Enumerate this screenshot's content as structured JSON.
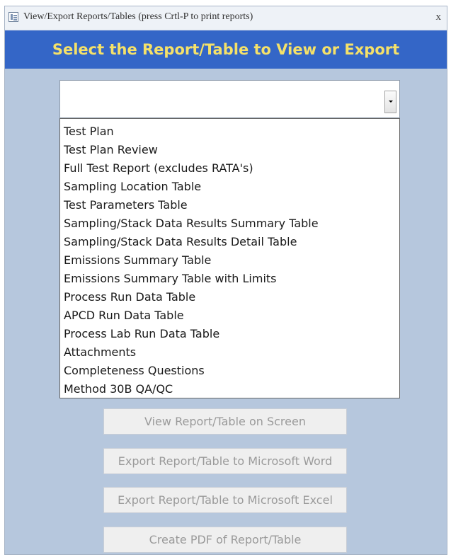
{
  "window": {
    "title": "View/Export Reports/Tables (press Crtl-P to print reports)",
    "close_label": "x"
  },
  "header": {
    "title": "Select the Report/Table to View or Export",
    "background": "#3466c7",
    "title_color": "#f5e169"
  },
  "combo": {
    "value": ""
  },
  "dropdown": {
    "items": [
      "Test Plan",
      "Test Plan Review",
      "Full Test Report (excludes RATA's)",
      "Sampling Location Table",
      "Test Parameters Table",
      "Sampling/Stack Data Results Summary Table",
      "Sampling/Stack Data Results Detail Table",
      "Emissions Summary Table",
      "Emissions Summary Table with Limits",
      "Process Run Data Table",
      "APCD Run Data Table",
      "Process Lab Run Data Table",
      "Attachments",
      "Completeness Questions",
      "Method 30B QA/QC"
    ]
  },
  "buttons": {
    "view_label": "View Report/Table on Screen",
    "export_word_label": "Export Report/Table to Microsoft Word",
    "export_excel_label": "Export Report/Table to Microsoft Excel",
    "pdf_label": "Create PDF of Report/Table"
  },
  "icons": {
    "window_icon": "form-icon",
    "dropdown_arrow": "chevron-down-icon"
  }
}
